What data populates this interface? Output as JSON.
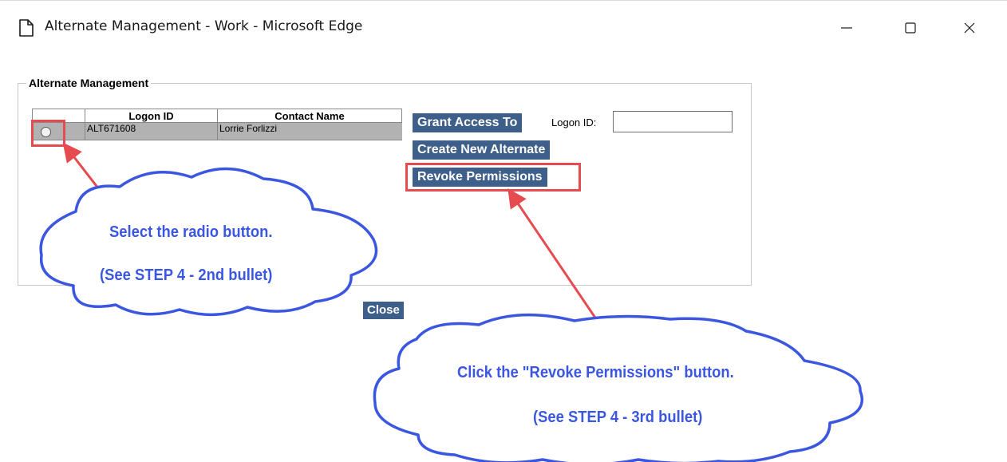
{
  "window": {
    "title": "Alternate Management - Work - Microsoft Edge",
    "icon": "page-icon",
    "controls": [
      "minimize-icon",
      "maximize-icon",
      "close-icon"
    ]
  },
  "panel": {
    "legend": "Alternate Management",
    "table": {
      "headers": [
        "",
        "Logon ID",
        "Contact Name"
      ],
      "rows": [
        {
          "logon_id": "ALT671608",
          "contact_name": "Lorrie Forlizzi"
        }
      ]
    },
    "buttons": {
      "grant_access": "Grant Access To",
      "create_alternate": "Create New Alternate",
      "revoke_permissions": "Revoke Permissions"
    },
    "logon_label": "Logon ID:",
    "logon_value": ""
  },
  "close_label": "Close",
  "callouts": {
    "left": {
      "line1": "Select the radio button.",
      "line2": "(See STEP 4 - 2nd bullet)"
    },
    "right": {
      "line1": "Click the \"Revoke Permissions\" button.",
      "line2": "(See STEP 4 - 3rd bullet)"
    }
  },
  "colors": {
    "button_bg": "#3e5f8a",
    "highlight": "#e64b50",
    "callout_text": "#3b57e0",
    "cloud_outline": "#3b57e0",
    "row_bg": "#b2b2b2"
  }
}
